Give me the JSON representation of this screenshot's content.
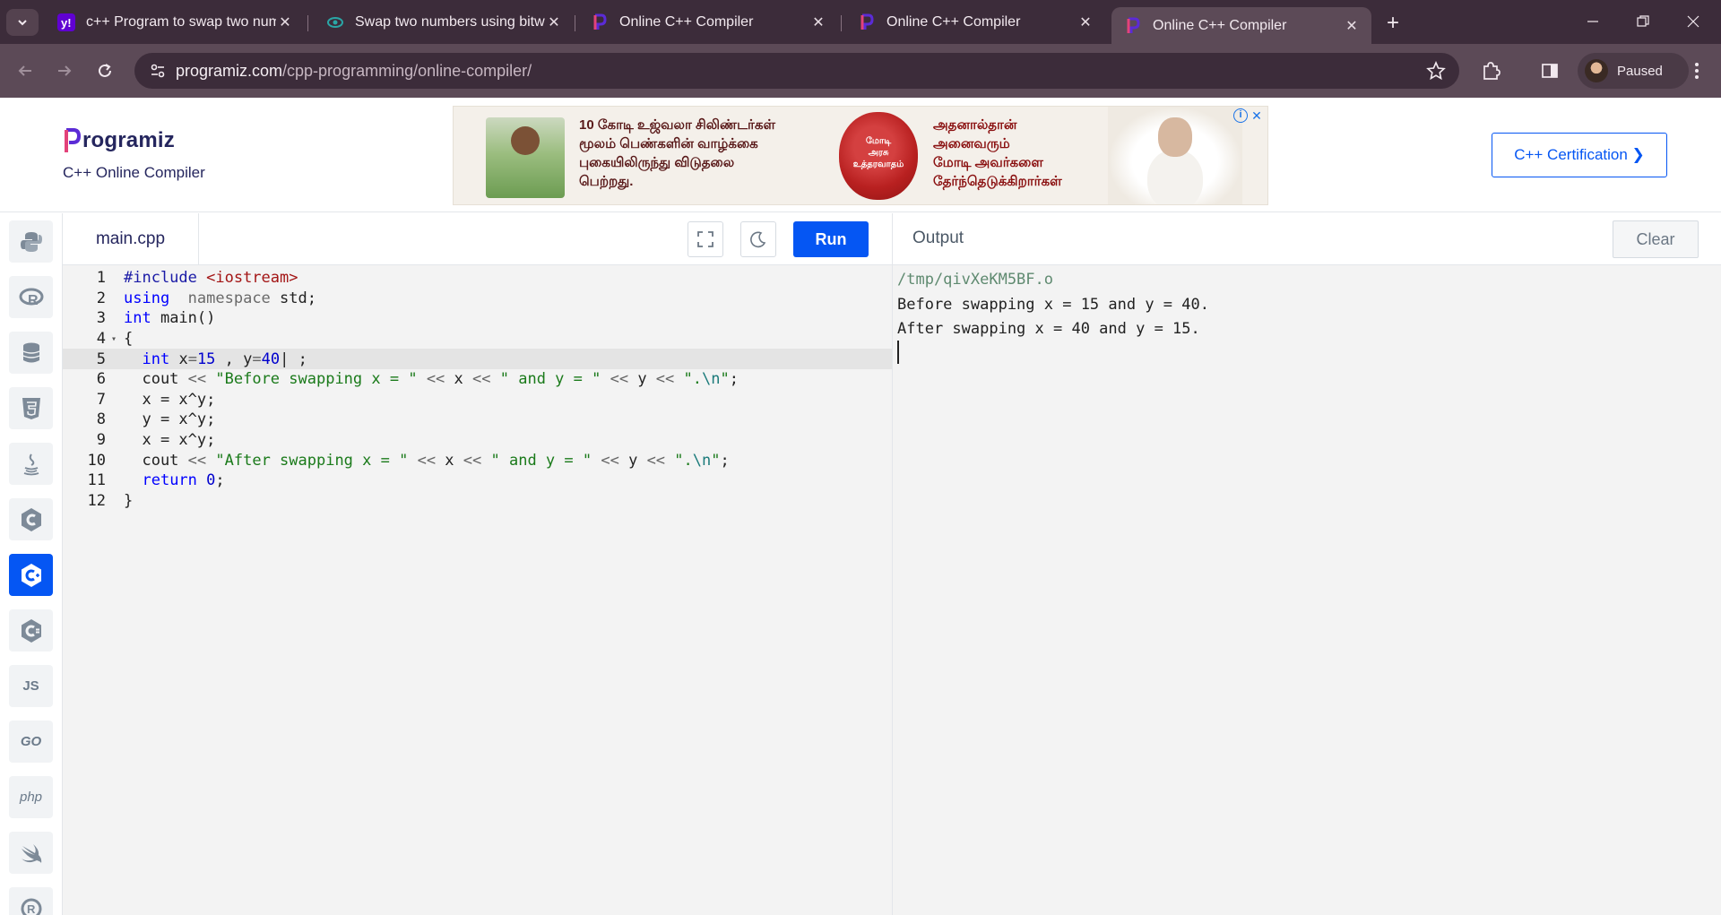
{
  "browser": {
    "tabs": [
      {
        "title": "c++ Program to swap two num",
        "favicon": "yahoo-icon"
      },
      {
        "title": "Swap two numbers using bitwis",
        "favicon": "eye-icon"
      },
      {
        "title": "Online C++ Compiler",
        "favicon": "programiz-icon"
      },
      {
        "title": "Online C++ Compiler",
        "favicon": "programiz-icon"
      },
      {
        "title": "Online C++ Compiler",
        "favicon": "programiz-icon"
      }
    ],
    "address_domain": "programiz.com",
    "address_path": "/cpp-programming/online-compiler/",
    "profile_label": "Paused"
  },
  "header": {
    "logo_text": "rogramiz",
    "subtitle": "C++ Online Compiler",
    "ad": {
      "text_left": [
        "10 கோடி உஜ்வலா சிலிண்டர்கள்",
        "மூலம் பெண்களின் வாழ்க்கை",
        "புகையிலிருந்து விடுதலை",
        "பெற்றது."
      ],
      "seal_text": [
        "மோடி",
        "அரசு",
        "உத்தரவாதம்"
      ],
      "text_right": [
        "அதனால்தான்",
        "அனைவரும்",
        "மோடி அவர்களை",
        "தேர்ந்தெடுக்கிறார்கள்"
      ]
    },
    "cert_button": "C++ Certification ❯"
  },
  "sidebar": {
    "items": [
      {
        "name": "python",
        "icon": "python-icon"
      },
      {
        "name": "r",
        "icon": "r-icon"
      },
      {
        "name": "sql",
        "icon": "database-icon"
      },
      {
        "name": "html",
        "icon": "html5-icon"
      },
      {
        "name": "java",
        "icon": "java-icon"
      },
      {
        "name": "c",
        "icon": "c-icon"
      },
      {
        "name": "cpp",
        "icon": "cpp-icon",
        "active": true
      },
      {
        "name": "csharp",
        "icon": "csharp-icon"
      },
      {
        "name": "js",
        "icon": "js-icon",
        "label": "JS"
      },
      {
        "name": "go",
        "icon": "go-icon",
        "label": "GO"
      },
      {
        "name": "php",
        "icon": "php-icon",
        "label": "php"
      },
      {
        "name": "swift",
        "icon": "swift-icon"
      },
      {
        "name": "rust",
        "icon": "rust-icon"
      }
    ]
  },
  "editor": {
    "filename": "main.cpp",
    "run_label": "Run",
    "highlighted_line": 5,
    "lines": [
      {
        "n": "1",
        "tokens": [
          [
            "pp",
            "#include "
          ],
          [
            "inc",
            "<iostream>"
          ]
        ]
      },
      {
        "n": "2",
        "tokens": [
          [
            "kw",
            "using"
          ],
          [
            "",
            "  "
          ],
          [
            "kw2",
            "namespace"
          ],
          [
            "",
            " std;"
          ]
        ]
      },
      {
        "n": "3",
        "tokens": [
          [
            "kw",
            "int"
          ],
          [
            "",
            " main()"
          ]
        ]
      },
      {
        "n": "4",
        "fold": true,
        "tokens": [
          [
            "",
            "{"
          ]
        ]
      },
      {
        "n": "5",
        "tokens": [
          [
            "",
            "  "
          ],
          [
            "kw",
            "int"
          ],
          [
            "",
            " x"
          ],
          [
            "op",
            "="
          ],
          [
            "num",
            "15"
          ],
          [
            "",
            " , y"
          ],
          [
            "op",
            "="
          ],
          [
            "num",
            "40"
          ],
          [
            "",
            "| ;"
          ]
        ]
      },
      {
        "n": "6",
        "tokens": [
          [
            "",
            "  cout "
          ],
          [
            "op",
            "<<"
          ],
          [
            "",
            " "
          ],
          [
            "str",
            "\"Before swapping x = \""
          ],
          [
            "",
            " "
          ],
          [
            "op",
            "<<"
          ],
          [
            "",
            " x "
          ],
          [
            "op",
            "<<"
          ],
          [
            "",
            " "
          ],
          [
            "str",
            "\" and y = \""
          ],
          [
            "",
            " "
          ],
          [
            "op",
            "<<"
          ],
          [
            "",
            " y "
          ],
          [
            "op",
            "<<"
          ],
          [
            "",
            " "
          ],
          [
            "str",
            "\"."
          ],
          [
            "esc",
            "\\n"
          ],
          [
            "str",
            "\""
          ],
          [
            "",
            ";"
          ]
        ]
      },
      {
        "n": "7",
        "tokens": [
          [
            "",
            "  x = x^y;"
          ]
        ]
      },
      {
        "n": "8",
        "tokens": [
          [
            "",
            "  y = x^y;"
          ]
        ]
      },
      {
        "n": "9",
        "tokens": [
          [
            "",
            "  x = x^y;"
          ]
        ]
      },
      {
        "n": "10",
        "tokens": [
          [
            "",
            "  cout "
          ],
          [
            "op",
            "<<"
          ],
          [
            "",
            " "
          ],
          [
            "str",
            "\"After swapping x = \""
          ],
          [
            "",
            " "
          ],
          [
            "op",
            "<<"
          ],
          [
            "",
            " x "
          ],
          [
            "op",
            "<<"
          ],
          [
            "",
            " "
          ],
          [
            "str",
            "\" and y = \""
          ],
          [
            "",
            " "
          ],
          [
            "op",
            "<<"
          ],
          [
            "",
            " y "
          ],
          [
            "op",
            "<<"
          ],
          [
            "",
            " "
          ],
          [
            "str",
            "\"."
          ],
          [
            "esc",
            "\\n"
          ],
          [
            "str",
            "\""
          ],
          [
            "",
            ";"
          ]
        ]
      },
      {
        "n": "11",
        "tokens": [
          [
            "",
            "  "
          ],
          [
            "kw",
            "return"
          ],
          [
            "",
            " "
          ],
          [
            "num",
            "0"
          ],
          [
            "",
            ";"
          ]
        ]
      },
      {
        "n": "12",
        "tokens": [
          [
            "",
            "}"
          ]
        ]
      }
    ]
  },
  "output": {
    "title": "Output",
    "clear_label": "Clear",
    "path_line": "/tmp/qivXeKM5BF.o",
    "lines": [
      "Before swapping x = 15 and y = 40.",
      "After swapping x = 40 and y = 15."
    ]
  }
}
